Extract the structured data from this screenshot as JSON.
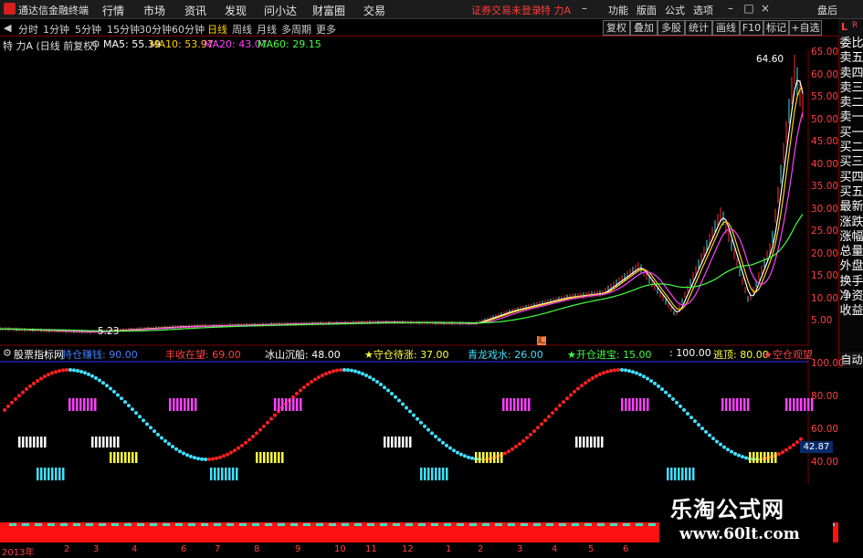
{
  "app": {
    "title": "通达信金融终端",
    "warning": "证券交易未登录",
    "stock_short": "特 力A"
  },
  "menu": [
    "行情",
    "市场",
    "资讯",
    "发现",
    "问小达",
    "财富圈",
    "交易"
  ],
  "top_links": [
    "功能",
    "版面",
    "公式",
    "选项",
    "盘后"
  ],
  "periods": [
    "分时",
    "1分钟",
    "5分钟",
    "15分钟",
    "30分钟",
    "60分钟",
    "日线",
    "周线",
    "月线",
    "多周期",
    "更多"
  ],
  "active_period": "日线",
  "toolbar": [
    "复权",
    "叠加",
    "多股",
    "统计",
    "画线",
    "F10",
    "标记",
    "+自选"
  ],
  "chart_header": {
    "stock": "特 力A (日线 前复权)",
    "ma5": "MA5: 55.39",
    "ma10": "MA10: 53.97",
    "ma20": "MA20: 43.07",
    "ma60": "MA60: 29.15"
  },
  "colors": {
    "ma5": "#ffffff",
    "ma10": "#ffd000",
    "ma20": "#ff40ff",
    "ma60": "#40ff40",
    "axis": "#ff4040",
    "up": "#ff3030",
    "down": "#40e0e0"
  },
  "right_sidebar": [
    "委比",
    "卖五",
    "卖四",
    "卖三",
    "卖二",
    "卖一",
    "买一",
    "买二",
    "买三",
    "买四",
    "买五",
    "最新",
    "涨跌",
    "涨幅",
    "总量",
    "外盘",
    "换手",
    "净资",
    "收益"
  ],
  "right_head": {
    "letter": "L",
    "sub": "R"
  },
  "price_axis": [
    "65.00",
    "60.00",
    "55.00",
    "50.00",
    "45.00",
    "40.00",
    "35.00",
    "30.00",
    "25.00",
    "20.00",
    "15.00",
    "10.00",
    "5.00"
  ],
  "annotations": {
    "high": "64.60",
    "low": "5.23",
    "marker": "汇"
  },
  "indicator": {
    "name": "股票指标网",
    "items": [
      {
        "label": "持仓赚钱: 90.00",
        "color": "#4080ff"
      },
      {
        "label": "丰收在望: 69.00",
        "color": "#ff4040"
      },
      {
        "label": "冰山沉船: 48.00",
        "color": "#ffffff"
      },
      {
        "label": "★守仓待涨: 37.00",
        "color": "#ffff40"
      },
      {
        "label": "青龙戏水: 26.00",
        "color": "#40e0ff"
      },
      {
        "label": "★开仓进宝: 15.00",
        "color": "#40ff40"
      },
      {
        "label": ": 100.00",
        "color": "#ffffff"
      },
      {
        "label": "逃顶: 80.00",
        "color": "#ffff40"
      },
      {
        "label": "★空仓观望",
        "color": "#ff4040"
      }
    ],
    "auto": "自动",
    "axis": [
      "100.00",
      "80.00",
      "60.00",
      "40.00"
    ],
    "current_value": "42.87"
  },
  "x_axis": [
    "2013年",
    "2",
    "3",
    "4",
    "6",
    "7",
    "8",
    "9",
    "10",
    "11",
    "12",
    "1",
    "2",
    "3",
    "4",
    "5",
    "6"
  ],
  "watermark": {
    "title": "乐淘公式网",
    "url": "www.60lt.com"
  }
}
